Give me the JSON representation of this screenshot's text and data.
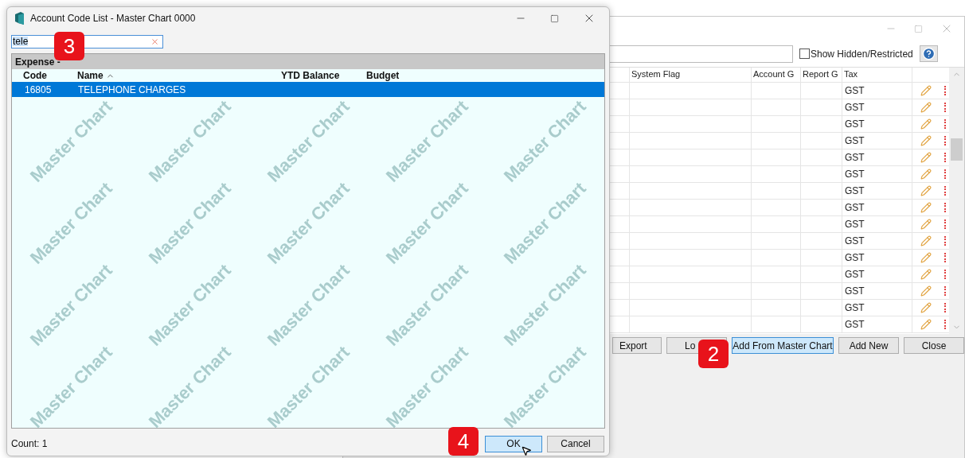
{
  "back_window": {
    "show_hidden": {
      "label": "Show Hidden/Restricted",
      "checked": false
    },
    "columns": [
      "System Flag",
      "Account G",
      "Report G",
      "Tax"
    ],
    "rows": [
      {
        "tax": "GST"
      },
      {
        "tax": "GST"
      },
      {
        "tax": "GST"
      },
      {
        "tax": "GST"
      },
      {
        "tax": "GST"
      },
      {
        "tax": "GST"
      },
      {
        "tax": "GST"
      },
      {
        "tax": "GST"
      },
      {
        "tax": "GST"
      },
      {
        "tax": "GST"
      },
      {
        "tax": "GST"
      },
      {
        "tax": "GST"
      },
      {
        "tax": "GST"
      },
      {
        "tax": "GST"
      },
      {
        "tax": "GST"
      }
    ],
    "buttons": [
      {
        "label": "Export",
        "focused": false
      },
      {
        "label": "Lo",
        "focused": false
      },
      {
        "label": "Add From Master Chart",
        "focused": true
      },
      {
        "label": "Add New",
        "focused": false
      },
      {
        "label": "Close",
        "focused": false
      }
    ]
  },
  "dialog": {
    "title": "Account Code List - Master Chart 0000",
    "search": {
      "value": "tele",
      "text_selected": true
    },
    "group": "Expense -",
    "columns": [
      "Code",
      "Name",
      "YTD Balance",
      "Budget"
    ],
    "rows": [
      {
        "code": "16805",
        "name": "TELEPHONE CHARGES",
        "selected": true
      }
    ],
    "watermarks": [
      "Master Chart",
      "Master Chart",
      "Master Chart",
      "Master Chart",
      "Master Chart",
      "Master Chart",
      "Master Chart",
      "Master Chart",
      "Master Chart",
      "Master Chart",
      "Master Chart",
      "Master Chart",
      "Master Chart",
      "Master Chart",
      "Master Chart",
      "Master Chart",
      "Master Chart",
      "Master Chart",
      "Master Chart",
      "Master Chart"
    ],
    "count": "Count: 1",
    "buttons": [
      {
        "label": "OK",
        "focused": true
      },
      {
        "label": "Cancel",
        "focused": false
      }
    ]
  },
  "callouts": [
    {
      "label": "3"
    },
    {
      "label": "2"
    },
    {
      "label": "4"
    }
  ]
}
